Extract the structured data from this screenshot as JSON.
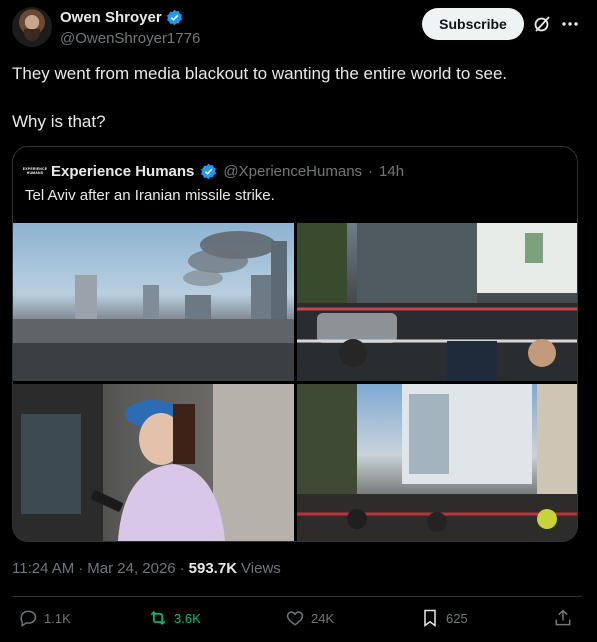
{
  "author": {
    "name": "Owen Shroyer",
    "handle": "@OwenShroyer1776",
    "subscribe_label": "Subscribe",
    "verified_icon": "verified-badge-icon",
    "grok_icon": "grok-icon",
    "more_icon": "more-options-icon"
  },
  "post": {
    "line1": "They went from media blackout to wanting the entire world to see.",
    "line2": "Why is that?"
  },
  "quote": {
    "avatar_text_1": "EXPERIENCE",
    "avatar_text_2": "HUMANS",
    "name": "Experience Humans",
    "handle": "@XperienceHumans",
    "separator": "·",
    "time": "14h",
    "text": "Tel Aviv after an Iranian missile strike."
  },
  "meta": {
    "time": "11:24 AM",
    "sep1": "·",
    "date": "Mar 24, 2026",
    "sep2": "·",
    "views_count": "593.7K",
    "views_label": "Views"
  },
  "actions": {
    "replies": "1.1K",
    "reposts": "3.6K",
    "likes": "24K",
    "bookmarks": "625"
  },
  "colors": {
    "background": "#000000",
    "text": "#e7e9ea",
    "muted": "#71767b",
    "verified": "#1d9bf0",
    "repost_active": "#00ba7c",
    "border": "#2f3336"
  }
}
